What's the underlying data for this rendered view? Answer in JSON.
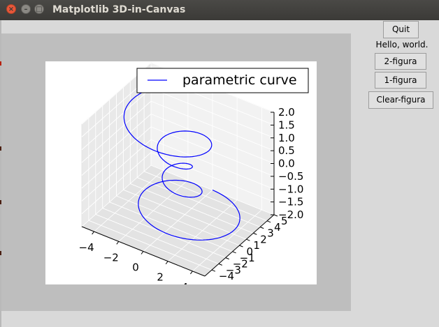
{
  "window": {
    "title": "Matplotlib 3D-in-Canvas"
  },
  "controls": {
    "quit_label": "Quit",
    "hello_text": "Hello, world.",
    "fig2_label": "2-figura",
    "fig1_label": "1-figura",
    "clear_label": "Clear-figura"
  },
  "chart_data": {
    "type": "line",
    "projection": "3d",
    "legend": {
      "placement": "upper-right",
      "entries": [
        "parametric curve"
      ]
    },
    "series": [
      {
        "name": "parametric curve",
        "color": "#0000ff",
        "parametrization": "theta from -4π to 4π; z from -2 to 2 linear in theta; r = z^2 + 1; x = r·sin(theta); y = r·cos(theta)",
        "theta_range": [
          -12.566,
          12.566
        ],
        "z_range": [
          -2,
          2
        ]
      }
    ],
    "x_axis": {
      "ticks": [
        "−4",
        "−2",
        "0",
        "2",
        "4"
      ],
      "range": [
        -5,
        5
      ]
    },
    "y_axis": {
      "ticks": [
        "−4",
        "−3",
        "−2",
        "−1",
        "0",
        "1",
        "2",
        "3",
        "4",
        "5"
      ],
      "range": [
        -5,
        5
      ]
    },
    "z_axis": {
      "ticks": [
        "−2.0",
        "−1.5",
        "−1.0",
        "−0.5",
        "0.0",
        "0.5",
        "1.0",
        "1.5",
        "2.0"
      ],
      "range": [
        -2,
        2
      ]
    },
    "grid": true
  }
}
